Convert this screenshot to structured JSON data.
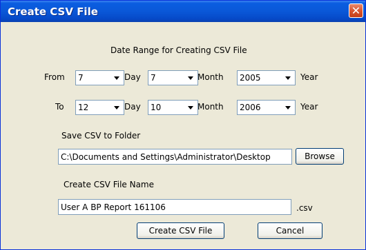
{
  "window": {
    "title": "Create CSV File",
    "close_glyph": "✕"
  },
  "heading": "Date Range for Creating CSV File",
  "from_row": {
    "label": "From",
    "day": "7",
    "day_unit": "Day",
    "month": "7",
    "month_unit": "Month",
    "year": "2005",
    "year_unit": "Year"
  },
  "to_row": {
    "label": "To",
    "day": "12",
    "day_unit": "Day",
    "month": "10",
    "month_unit": "Month",
    "year": "2006",
    "year_unit": "Year"
  },
  "folder": {
    "label": "Save CSV to Folder",
    "value": "C:\\Documents and Settings\\Administrator\\Desktop",
    "browse_label": "Browse"
  },
  "file": {
    "label": "Create CSV File Name",
    "value": "User A BP Report 161106",
    "extension": ".csv"
  },
  "buttons": {
    "create": "Create CSV File",
    "cancel": "Cancel"
  },
  "colors": {
    "title_bar": "#0a58d8",
    "close": "#d8522c",
    "face": "#ece9d8",
    "border": "#7f9db9"
  }
}
